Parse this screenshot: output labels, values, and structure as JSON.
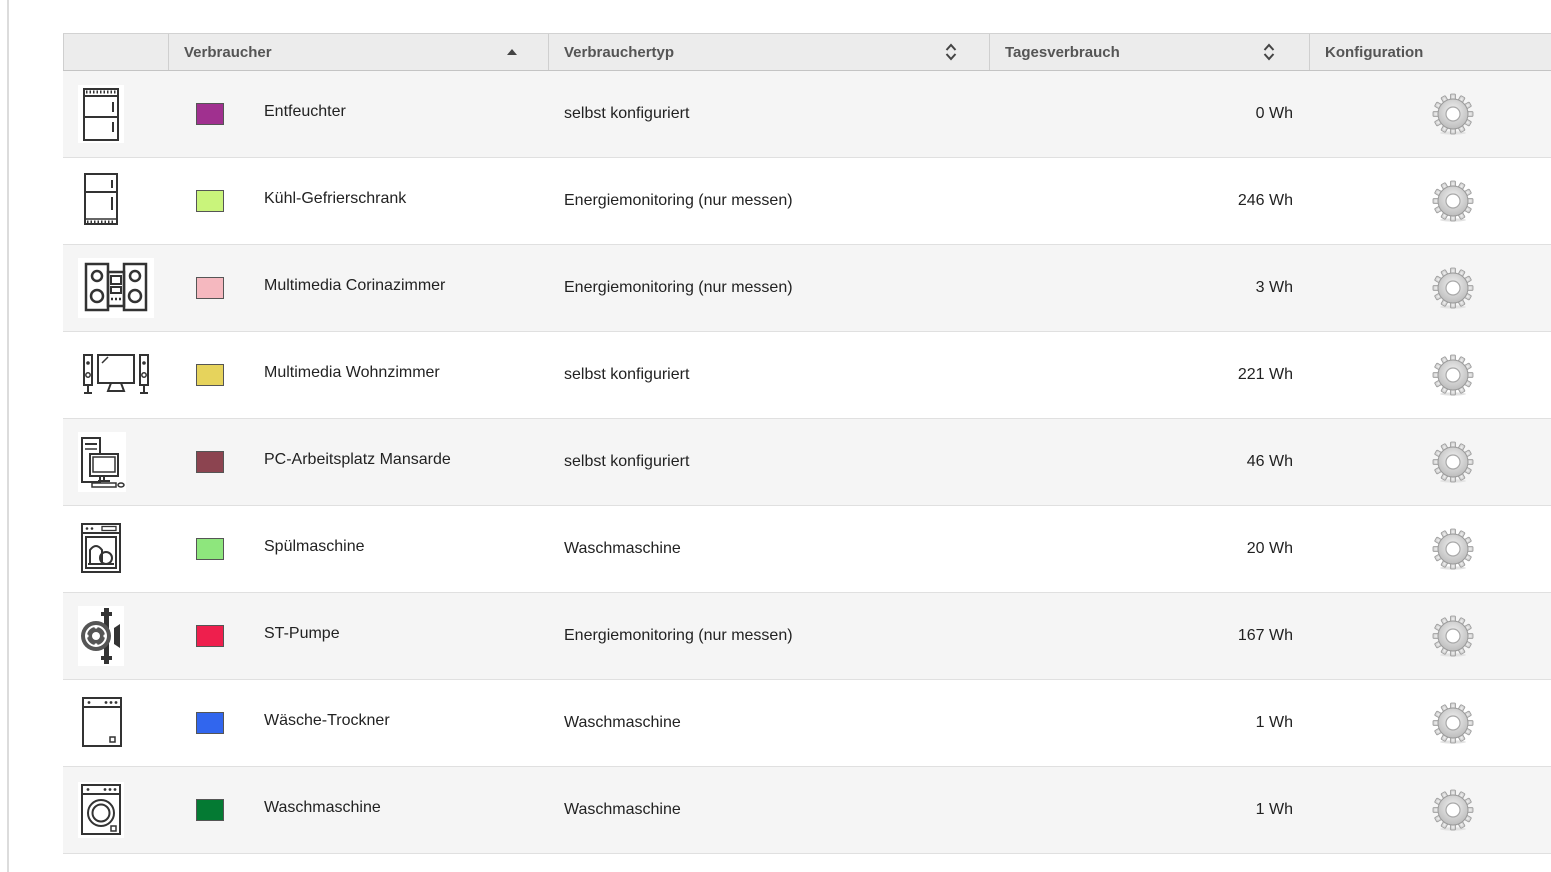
{
  "columns": [
    {
      "label": ""
    },
    {
      "label": "Verbraucher",
      "sort": "asc"
    },
    {
      "label": "Verbrauchertyp",
      "sort": "none"
    },
    {
      "label": "Tagesverbrauch",
      "sort": "none"
    },
    {
      "label": "Konfiguration"
    }
  ],
  "rows": [
    {
      "icon": "dehumidifier-icon",
      "color": "#a0308f",
      "name": "Entfeuchter",
      "type": "selbst konfiguriert",
      "consumption": "0 Wh"
    },
    {
      "icon": "fridge-freezer-icon",
      "color": "#c9f47b",
      "name": "Kühl-Gefrierschrank",
      "type": "Energiemonitoring (nur messen)",
      "consumption": "246 Wh"
    },
    {
      "icon": "stereo-system-icon",
      "color": "#f5b8bf",
      "name": "Multimedia Corinazimmer",
      "type": "Energiemonitoring (nur messen)",
      "consumption": "3 Wh"
    },
    {
      "icon": "tv-speakers-icon",
      "color": "#e6d35c",
      "name": "Multimedia Wohnzimmer",
      "type": "selbst konfiguriert",
      "consumption": "221 Wh"
    },
    {
      "icon": "pc-workstation-icon",
      "color": "#8c4450",
      "name": "PC-Arbeitsplatz Mansarde",
      "type": "selbst konfiguriert",
      "consumption": "46 Wh"
    },
    {
      "icon": "dishwasher-icon",
      "color": "#8ee67d",
      "name": "Spülmaschine",
      "type": "Waschmaschine",
      "consumption": "20 Wh"
    },
    {
      "icon": "pump-icon",
      "color": "#ee1f4d",
      "name": "ST-Pumpe",
      "type": "Energiemonitoring (nur messen)",
      "consumption": "167 Wh"
    },
    {
      "icon": "dryer-icon",
      "color": "#3166ee",
      "name": "Wäsche-Trockner",
      "type": "Waschmaschine",
      "consumption": "1 Wh"
    },
    {
      "icon": "washing-machine-icon",
      "color": "#047a33",
      "name": "Waschmaschine",
      "type": "Waschmaschine",
      "consumption": "1 Wh"
    }
  ]
}
